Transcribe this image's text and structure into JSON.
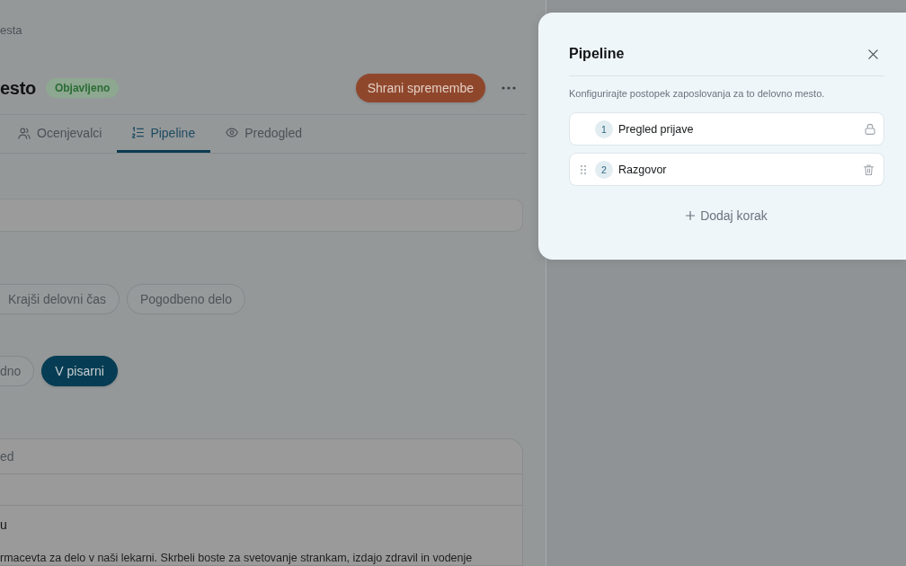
{
  "breadcrumb": "esta",
  "header": {
    "title": "esto",
    "status": "Objavljeno",
    "save_button": "Shrani spremembe"
  },
  "tabs": [
    {
      "label": "Ocenjevalci",
      "selected": false
    },
    {
      "label": "Pipeline",
      "selected": true
    },
    {
      "label": "Predogled",
      "selected": false
    }
  ],
  "chip_groups": [
    {
      "chips": [
        {
          "label": "Krajši delovni čas",
          "selected": false
        },
        {
          "label": "Pogodbeno delo",
          "selected": false
        }
      ]
    },
    {
      "chips": [
        {
          "label": "dno",
          "selected": false
        },
        {
          "label": "V pisarni",
          "selected": true
        }
      ]
    }
  ],
  "card": {
    "header": "ed",
    "section_label": "u",
    "text": "rmacevta za delo v naši lekarni. Skrbeli boste za svetovanje strankam, izdajo zdravil in vodenje"
  },
  "pipeline_panel": {
    "title": "Pipeline",
    "description": "Konfigurirajte postopek zaposlovanja za to delovno mesto.",
    "steps": [
      {
        "number": "1",
        "name": "Pregled prijave",
        "locked": true
      },
      {
        "number": "2",
        "name": "Razgovor",
        "locked": false
      }
    ],
    "add_button": "Dodaj korak"
  }
}
